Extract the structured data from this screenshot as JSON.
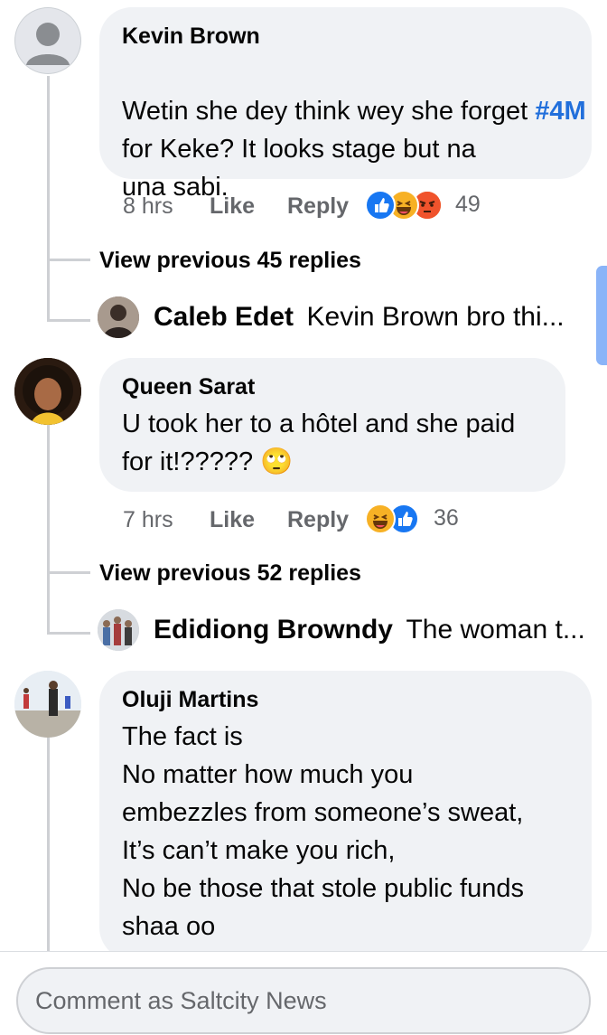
{
  "comments": [
    {
      "author": "Kevin Brown",
      "text_before": "Wetin she dey think wey she forget ",
      "hashtag": "#4M",
      "text_after": " for Keke? It looks stage but na\nuna sabi.",
      "time": "8 hrs",
      "like_label": "Like",
      "reply_label": "Reply",
      "reactions": [
        "like",
        "haha",
        "angry"
      ],
      "reaction_count": "49",
      "view_previous": "View previous 45 replies",
      "latest_reply": {
        "name": "Caleb Edet",
        "snippet": "Kevin Brown bro thi..."
      }
    },
    {
      "author": "Queen Sarat",
      "text": "U took her to a hôtel and she paid\nfor it!????? 🙄",
      "time": "7 hrs",
      "like_label": "Like",
      "reply_label": "Reply",
      "reactions": [
        "haha",
        "like"
      ],
      "reaction_count": "36",
      "view_previous": "View previous 52 replies",
      "latest_reply": {
        "name": "Edidiong Browndy",
        "snippet": "The woman t..."
      }
    },
    {
      "author": "Oluji Martins",
      "text": "The fact is\nNo matter how much you\nembezzles from someone’s sweat,\nIt’s can’t make you rich,\nNo be those that stole public funds\nshaa oo"
    }
  ],
  "composer": {
    "placeholder": "Comment as Saltcity News"
  },
  "icons": {
    "like_reaction": "like-reaction-icon",
    "haha_reaction": "haha-reaction-icon",
    "angry_reaction": "angry-reaction-icon"
  },
  "colors": {
    "accent": "#1877f2",
    "hashtag": "#216fdb",
    "bubble": "#f0f2f5",
    "meta": "#65676b"
  }
}
